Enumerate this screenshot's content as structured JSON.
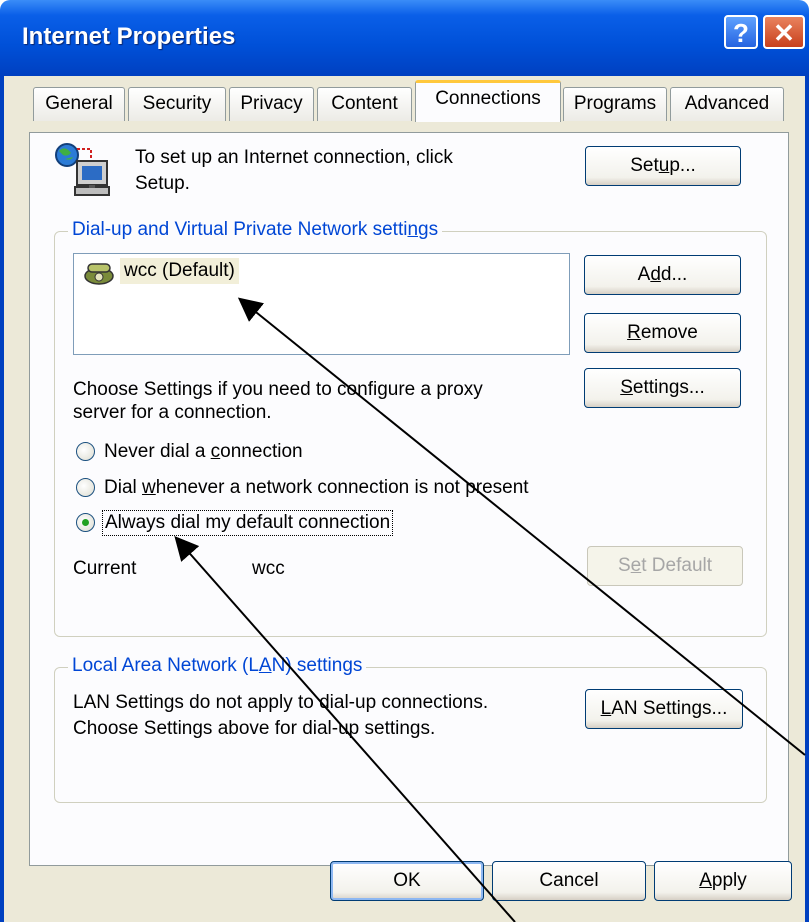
{
  "window": {
    "title": "Internet Properties",
    "help_glyph": "?",
    "close_glyph": "✕"
  },
  "tabs": [
    {
      "label": "General"
    },
    {
      "label": "Security"
    },
    {
      "label": "Privacy"
    },
    {
      "label": "Content"
    },
    {
      "label": "Connections",
      "active": true
    },
    {
      "label": "Programs"
    },
    {
      "label": "Advanced"
    }
  ],
  "setup": {
    "text_line1": "To set up an Internet connection, click",
    "text_line2": "Setup.",
    "button_pre": "Set",
    "button_mnemonic": "u",
    "button_post": "p..."
  },
  "dialup": {
    "legend_pre": "Dial-up and Virtual Private Network setti",
    "legend_mnemonic": "n",
    "legend_post": "gs",
    "connections": [
      "wcc (Default)"
    ],
    "add_pre": "A",
    "add_mnemonic": "d",
    "add_post": "d...",
    "remove_mnemonic": "R",
    "remove_post": "emove",
    "proxy_line1": "Choose Settings if you need to configure a proxy",
    "proxy_line2": "server for a connection.",
    "settings_mnemonic": "S",
    "settings_post": "ettings...",
    "radio_never_pre": "Never dial a ",
    "radio_never_mnemonic": "c",
    "radio_never_post": "onnection",
    "radio_whenever_pre": "Dial ",
    "radio_whenever_mnemonic": "w",
    "radio_whenever_post": "henever a network connection is not present",
    "radio_always_label": "Always dial my default connection",
    "selected_option": "Always dial my default connection",
    "current_label": "Current",
    "current_value": "wcc",
    "set_default_pre": "S",
    "set_default_mnemonic": "e",
    "set_default_post": "t Default"
  },
  "lan": {
    "legend_pre": "Local Area Network (L",
    "legend_mnemonic": "A",
    "legend_post": "N) settings",
    "text_line1": "LAN Settings do not apply to dial-up connections.",
    "text_line2": "Choose Settings above for dial-up settings.",
    "button_mnemonic": "L",
    "button_post": "AN Settings..."
  },
  "footer": {
    "ok": "OK",
    "cancel": "Cancel",
    "apply_mnemonic": "A",
    "apply_post": "pply"
  },
  "colors": {
    "titlebar": "#0050d8",
    "frame": "#ece9d8",
    "group_label": "#0046d5",
    "active_tab_highlight": "#ffc83c"
  }
}
